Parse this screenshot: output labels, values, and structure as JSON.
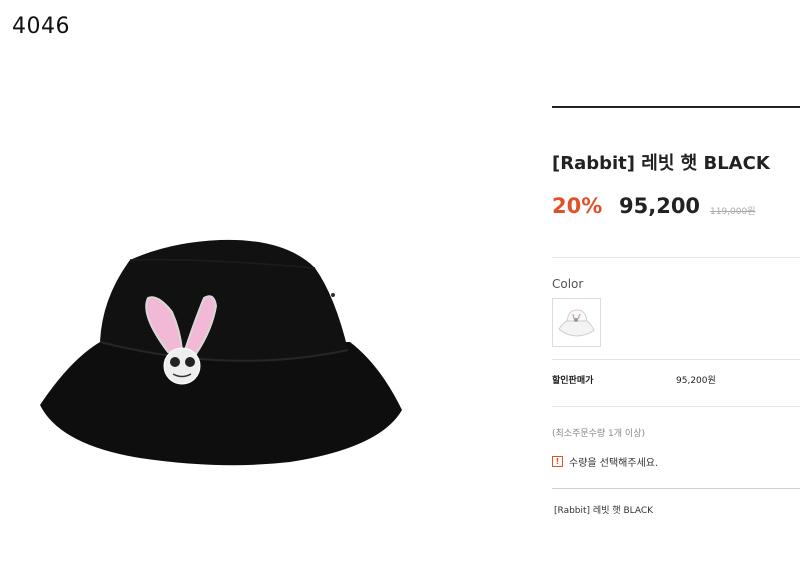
{
  "page": {
    "code": "4046"
  },
  "product": {
    "title": "[Rabbit] 레빗 햇 BLACK",
    "discount": "20%",
    "price": "95,200",
    "original_price": "119,000원"
  },
  "options": {
    "color_label": "Color",
    "selected_swatch_icon": "white-rabbit-bucket-hat-thumbnail"
  },
  "summary": {
    "sale_price_label": "할인판매가",
    "sale_price_value": "95,200원"
  },
  "order": {
    "min_order_text": "(최소주문수량 1개 이상)",
    "notice_icon": "!",
    "notice_text": "수량을 선택해주세요."
  },
  "selection": {
    "item_text": "[Rabbit] 레빗 햇 BLACK"
  },
  "colors": {
    "discount": "#e0512a",
    "hat_body": "#0c0c0c",
    "rabbit_ears": "#f1b9d6"
  }
}
